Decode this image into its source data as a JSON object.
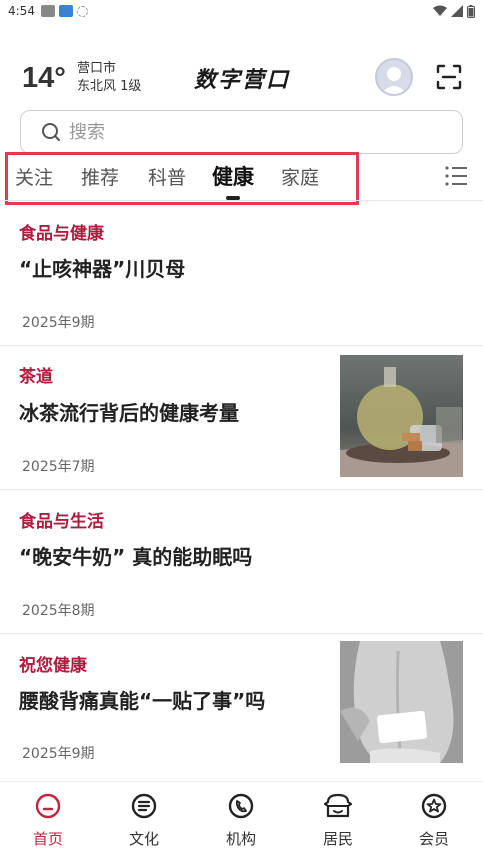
{
  "status_bar": {
    "time": "4:54"
  },
  "header": {
    "temperature": "14°",
    "city": "营口市",
    "wind": "东北风  1级",
    "app_title": "数字营口"
  },
  "search": {
    "placeholder": "搜索"
  },
  "tabs": [
    {
      "label": "关注"
    },
    {
      "label": "推荐"
    },
    {
      "label": "科普"
    },
    {
      "label": "健康",
      "active": true
    },
    {
      "label": "家庭"
    }
  ],
  "articles": [
    {
      "tag": "食品与健康",
      "title": "“止咳神器”川贝母",
      "issue": "2025年9期"
    },
    {
      "tag": "茶道",
      "title": "冰茶流行背后的健康考量",
      "issue": "2025年7期",
      "thumbnail": "iced-tea-photo"
    },
    {
      "tag": "食品与生活",
      "title": "“晚安牛奶” 真的能助眠吗",
      "issue": "2025年8期"
    },
    {
      "tag": "祝您健康",
      "title": "腰酸背痛真能“一贴了事”吗",
      "issue": "2025年9期",
      "thumbnail": "back-plaster-photo"
    }
  ],
  "bottom_nav": [
    {
      "label": "首页",
      "icon": "home-icon",
      "active": true
    },
    {
      "label": "文化",
      "icon": "culture-icon"
    },
    {
      "label": "机构",
      "icon": "phone-icon"
    },
    {
      "label": "居民",
      "icon": "resident-icon"
    },
    {
      "label": "会员",
      "icon": "member-star-icon"
    }
  ],
  "colors": {
    "accent": "#c8203e",
    "tag": "#b01b3e",
    "highlight_box": "#e33b4a"
  }
}
